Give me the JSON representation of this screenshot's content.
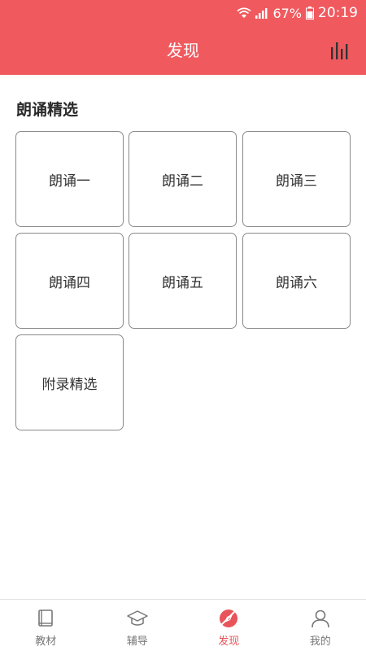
{
  "status_bar": {
    "battery": "67%",
    "time": "20:19"
  },
  "header": {
    "title": "发现",
    "right_icon": "bar-chart-icon"
  },
  "section": {
    "title": "朗诵精选",
    "cards": [
      {
        "label": "朗诵一"
      },
      {
        "label": "朗诵二"
      },
      {
        "label": "朗诵三"
      },
      {
        "label": "朗诵四"
      },
      {
        "label": "朗诵五"
      },
      {
        "label": "朗诵六"
      },
      {
        "label": "附录精选"
      }
    ]
  },
  "bottom_nav": {
    "items": [
      {
        "label": "教材",
        "icon": "book-icon",
        "active": false
      },
      {
        "label": "辅导",
        "icon": "graduation-cap-icon",
        "active": false
      },
      {
        "label": "发现",
        "icon": "discover-icon",
        "active": true
      },
      {
        "label": "我的",
        "icon": "user-icon",
        "active": false
      }
    ]
  },
  "colors": {
    "primary": "#f05a5f",
    "active_tab": "#e8545a"
  }
}
